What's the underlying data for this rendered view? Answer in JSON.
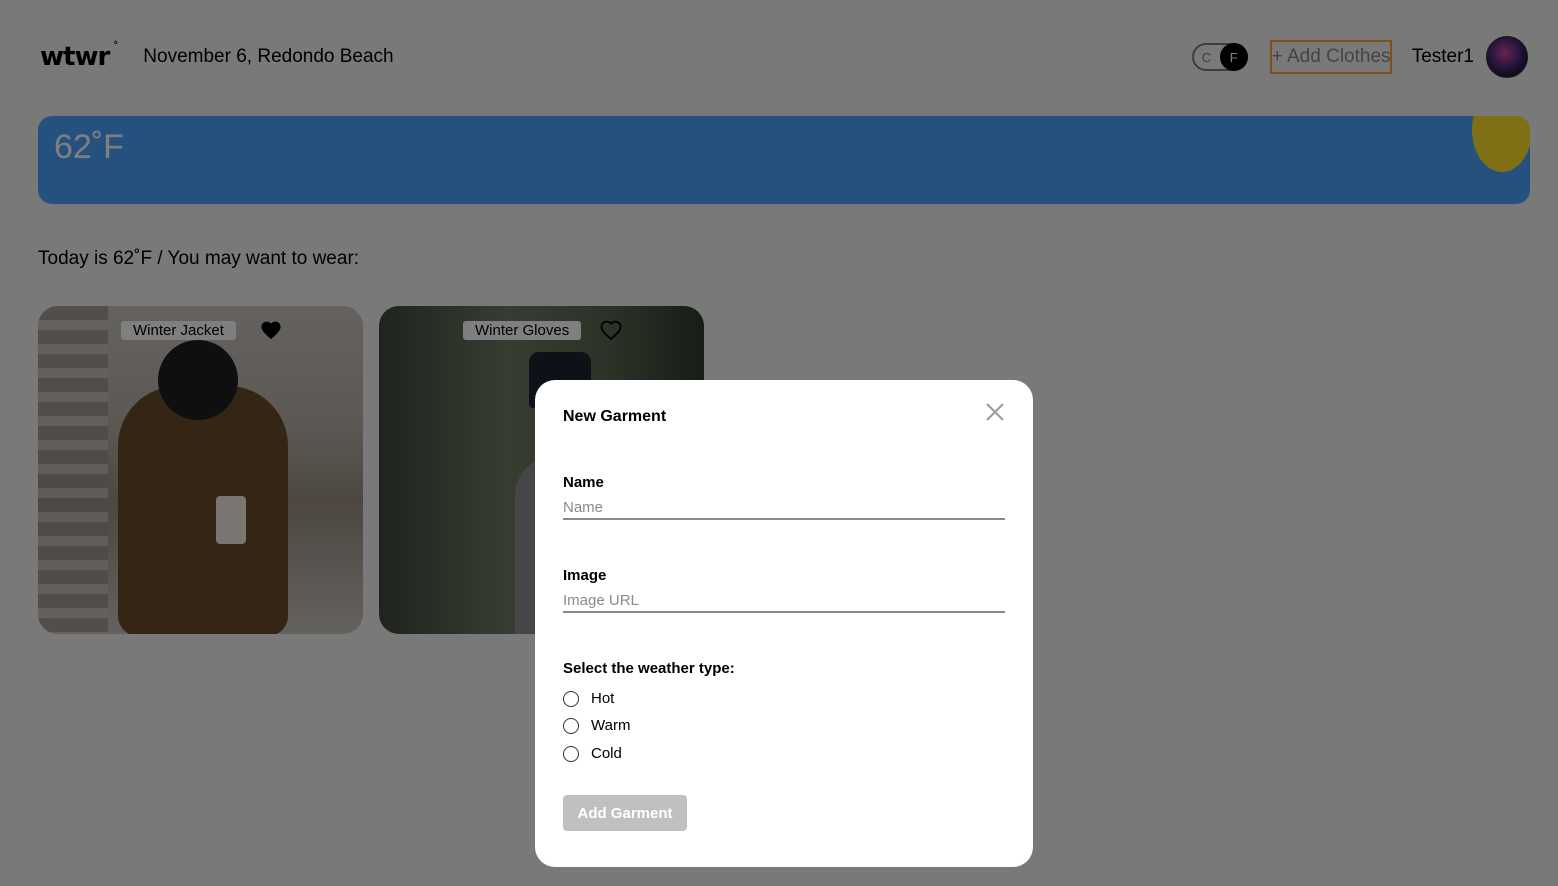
{
  "header": {
    "logo": "wtwr",
    "logo_mark": "°",
    "date_location": "November 6, Redondo Beach",
    "toggle": {
      "c_label": "C",
      "f_label": "F",
      "selected": "F"
    },
    "add_clothes_label": "+ Add Clothes",
    "username": "Tester1"
  },
  "weather": {
    "temperature": "62˚F",
    "card_color": "#4aa3ff",
    "sun_color": "#ffdf2b"
  },
  "main": {
    "today_text": "Today is 62˚F / You may want to wear:",
    "cards": [
      {
        "name": "Winter Jacket",
        "liked": true
      },
      {
        "name": "Winter Gloves",
        "liked": false
      }
    ]
  },
  "modal": {
    "title": "New Garment",
    "name_label": "Name",
    "name_placeholder": "Name",
    "image_label": "Image",
    "image_placeholder": "Image URL",
    "weather_label": "Select the weather type:",
    "options": [
      "Hot",
      "Warm",
      "Cold"
    ],
    "submit_label": "Add Garment"
  },
  "colors": {
    "accent_orange": "#ff9f3d",
    "submit_disabled": "#c0c0c0"
  }
}
